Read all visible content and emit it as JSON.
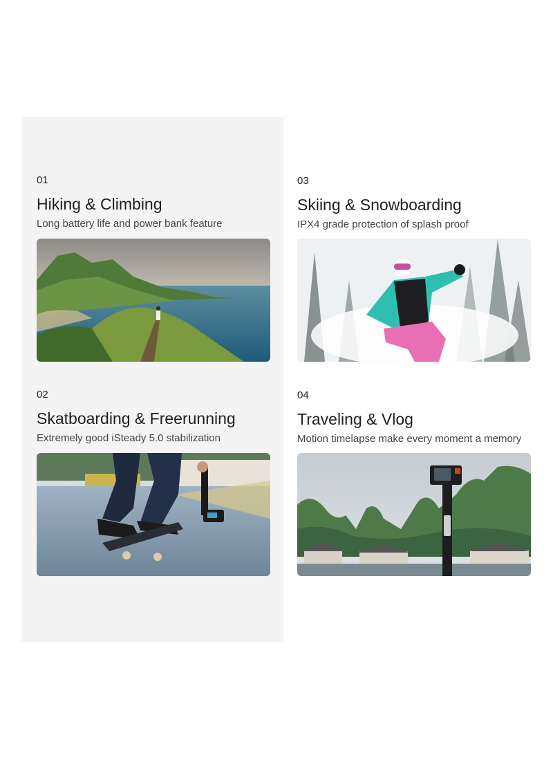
{
  "sections": [
    {
      "number": "01",
      "title": "Hiking & Climbing",
      "subtitle": "Long battery life and power bank feature"
    },
    {
      "number": "02",
      "title": "Skatboarding & Freerunning",
      "subtitle": "Extremely good iSteady 5.0 stabilization"
    },
    {
      "number": "03",
      "title": "Skiing & Snowboarding",
      "subtitle": "IPX4 grade protection of splash proof"
    },
    {
      "number": "04",
      "title": "Traveling & Vlog",
      "subtitle": "Motion timelapse make every moment a memory"
    }
  ],
  "images": {
    "hiking": "hiking-coast-photo",
    "skate": "skateboard-gimbal-photo",
    "ski": "snowboard-jump-photo",
    "vlog": "gimbal-karst-mountains-photo"
  },
  "colors": {
    "panel_bg": "#f4f4f4",
    "text": "#222222"
  }
}
